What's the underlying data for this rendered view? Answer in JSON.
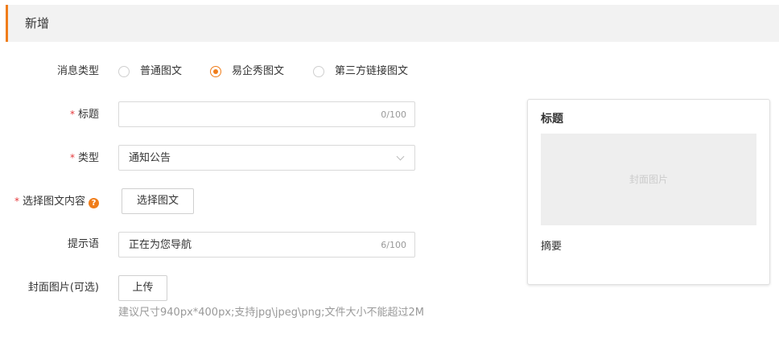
{
  "header": {
    "title": "新增"
  },
  "message_type": {
    "label": "消息类型",
    "options": [
      "普通图文",
      "易企秀图文",
      "第三方链接图文"
    ],
    "selected": "易企秀图文"
  },
  "title_field": {
    "label": "标题",
    "value": "",
    "count": "0/100"
  },
  "type_field": {
    "label": "类型",
    "value": "通知公告"
  },
  "content_field": {
    "label": "选择图文内容",
    "help_icon": "?",
    "button": "选择图文"
  },
  "prompt_field": {
    "label": "提示语",
    "value": "正在为您导航",
    "count": "6/100"
  },
  "cover_field": {
    "label": "封面图片(可选)",
    "button": "上传",
    "hint": "建议尺寸940px*400px;支持jpg\\jpeg\\png;文件大小不能超过2M"
  },
  "required_mark": "*",
  "preview": {
    "title": "标题",
    "cover_placeholder": "封面图片",
    "summary": "摘要"
  },
  "colors": {
    "accent": "#f07d1a",
    "required": "#e4393c",
    "header_bg": "#f2f2f2"
  }
}
